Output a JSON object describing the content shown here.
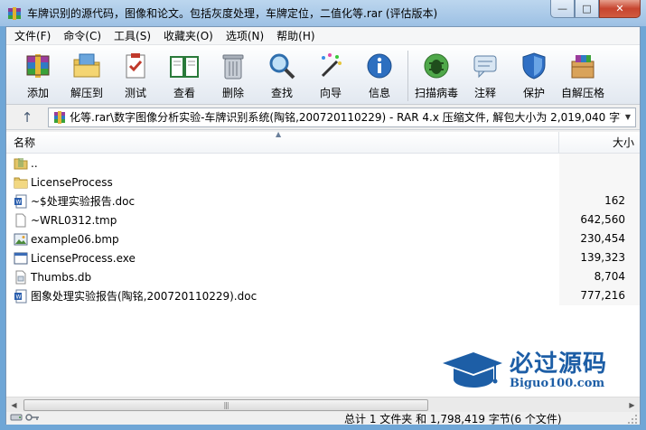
{
  "window": {
    "title": "车牌识别的源代码，图像和论文。包括灰度处理，车牌定位，二值化等.rar (评估版本)",
    "minimize_glyph": "—",
    "maximize_glyph": "□",
    "close_glyph": "✕"
  },
  "menu": [
    {
      "label": "文件(F)"
    },
    {
      "label": "命令(C)"
    },
    {
      "label": "工具(S)"
    },
    {
      "label": "收藏夹(O)"
    },
    {
      "label": "选项(N)"
    },
    {
      "label": "帮助(H)"
    }
  ],
  "toolbar": [
    {
      "label": "添加",
      "icon": "add-archive-icon"
    },
    {
      "label": "解压到",
      "icon": "extract-to-icon"
    },
    {
      "label": "测试",
      "icon": "test-icon"
    },
    {
      "label": "查看",
      "icon": "view-book-icon"
    },
    {
      "label": "删除",
      "icon": "delete-trash-icon"
    },
    {
      "label": "查找",
      "icon": "find-magnifier-icon"
    },
    {
      "label": "向导",
      "icon": "wizard-wand-icon"
    },
    {
      "label": "信息",
      "icon": "info-icon"
    },
    {
      "label": "扫描病毒",
      "icon": "virus-scan-icon"
    },
    {
      "label": "注释",
      "icon": "comment-icon"
    },
    {
      "label": "保护",
      "icon": "protect-shield-icon"
    },
    {
      "label": "自解压格",
      "icon": "sfx-box-icon"
    }
  ],
  "address": {
    "text": "化等.rar\\数字图像分析实验-车牌识别系统(陶铭,200720110229) - RAR 4.x 压缩文件, 解包大小为 2,019,040 字节",
    "up_glyph": "↑",
    "dropdown_glyph": "▼"
  },
  "columns": {
    "name": "名称",
    "size": "大小",
    "sort_glyph": "▲"
  },
  "files": [
    {
      "name": "..",
      "size": "",
      "icon": "parent-folder-icon"
    },
    {
      "name": "LicenseProcess",
      "size": "",
      "icon": "folder-icon"
    },
    {
      "name": "~$处理实验报告.doc",
      "size": "162",
      "icon": "word-doc-icon"
    },
    {
      "name": "~WRL0312.tmp",
      "size": "642,560",
      "icon": "blank-file-icon"
    },
    {
      "name": "example06.bmp",
      "size": "230,454",
      "icon": "bitmap-image-icon"
    },
    {
      "name": "LicenseProcess.exe",
      "size": "139,323",
      "icon": "exe-window-icon"
    },
    {
      "name": "Thumbs.db",
      "size": "8,704",
      "icon": "db-file-icon"
    },
    {
      "name": "图象处理实验报告(陶铭,200720110229).doc",
      "size": "777,216",
      "icon": "word-doc-icon"
    }
  ],
  "watermark": {
    "cn": "必过源码",
    "en": "Biguo100.com"
  },
  "scrollbar": {
    "left_glyph": "◀",
    "right_glyph": "▶",
    "thumb_grip": "|||"
  },
  "status": {
    "text": "总计 1 文件夹 和 1,798,419 字节(6 个文件)"
  }
}
